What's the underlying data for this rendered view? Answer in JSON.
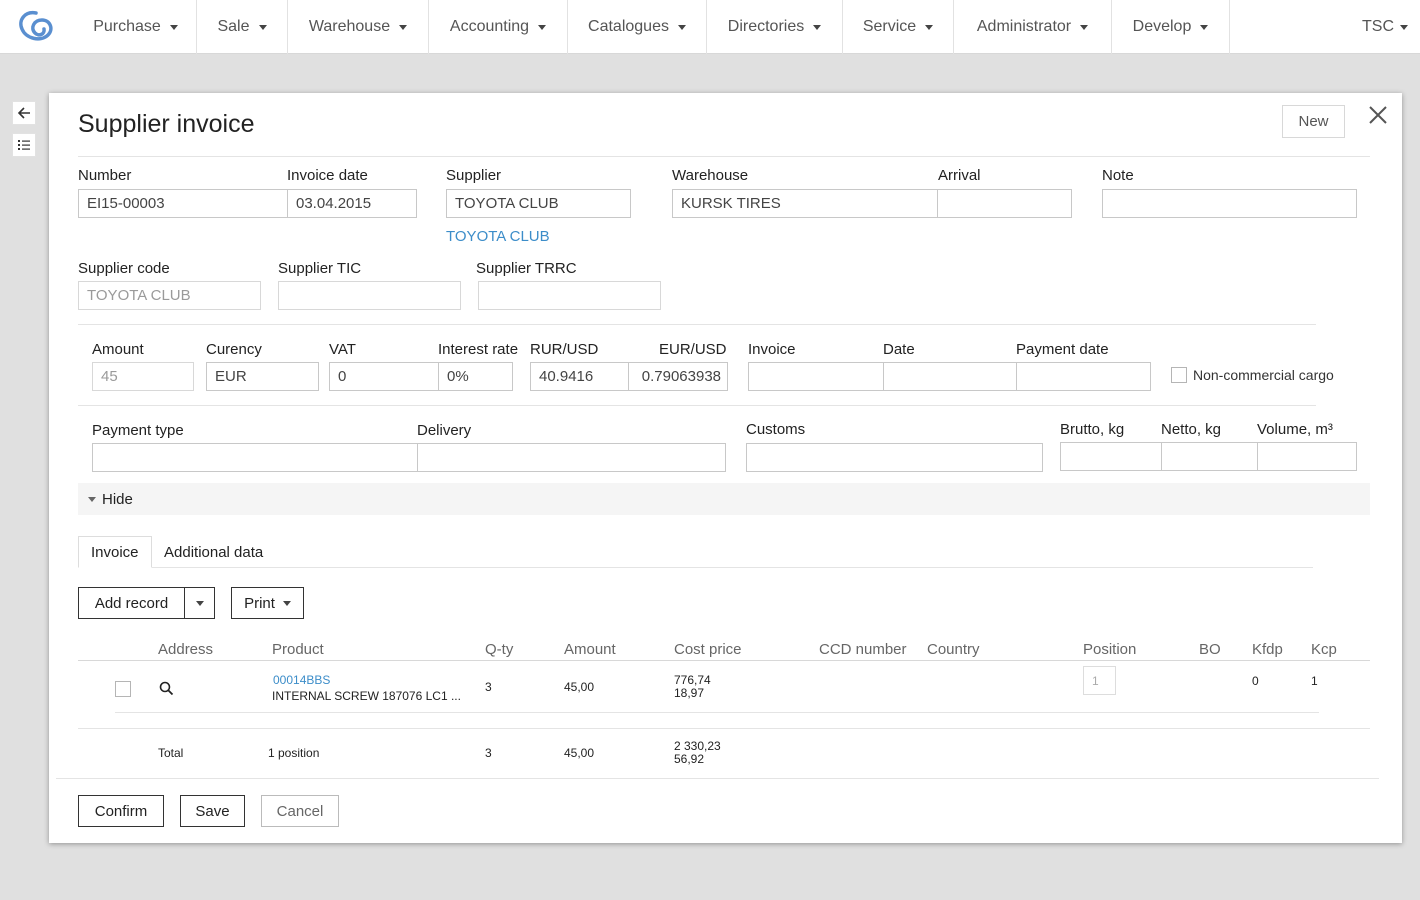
{
  "nav": {
    "items": [
      "Purchase",
      "Sale",
      "Warehouse",
      "Accounting",
      "Catalogues",
      "Directories",
      "Service",
      "Administrator",
      "Develop"
    ],
    "user": "TSC"
  },
  "modal": {
    "title": "Supplier invoice",
    "new_label": "New"
  },
  "header_fields": {
    "number_label": "Number",
    "number_value": "EI15-00003",
    "invoice_date_label": "Invoice date",
    "invoice_date_value": "03.04.2015",
    "supplier_label": "Supplier",
    "supplier_value": "TOYOTA CLUB",
    "supplier_link": "TOYOTA CLUB",
    "warehouse_label": "Warehouse",
    "warehouse_value": "KURSK TIRES",
    "arrival_label": "Arrival",
    "arrival_value": "",
    "note_label": "Note",
    "note_value": ""
  },
  "supplier_fields": {
    "code_label": "Supplier code",
    "code_value": "TOYOTA CLUB",
    "tic_label": "Supplier TIC",
    "tic_value": "",
    "trrc_label": "Supplier TRRC",
    "trrc_value": ""
  },
  "finance": {
    "amount_label": "Amount",
    "amount_value": "45",
    "currency_label": "Curency",
    "currency_value": "EUR",
    "vat_label": "VAT",
    "vat_value": "0",
    "interest_label": "Interest rate",
    "interest_value": "0%",
    "rur_usd_label": "RUR/USD",
    "rur_usd_value": "40.9416",
    "eur_usd_label": "EUR/USD",
    "eur_usd_value": "0.79063938",
    "invoice_label": "Invoice",
    "invoice_value": "",
    "date_label": "Date",
    "date_value": "",
    "payment_date_label": "Payment date",
    "payment_date_value": "",
    "noncommercial_label": "Non-commercial cargo"
  },
  "logistics": {
    "payment_type_label": "Payment type",
    "payment_type_value": "",
    "delivery_label": "Delivery",
    "delivery_value": "",
    "customs_label": "Customs",
    "customs_value": "",
    "brutto_label": "Brutto, kg",
    "brutto_value": "",
    "netto_label": "Netto, kg",
    "netto_value": "",
    "volume_label": "Volume, m³",
    "volume_value": ""
  },
  "hide_label": "Hide",
  "tabs": [
    "Invoice",
    "Additional data"
  ],
  "toolbar": {
    "add_record": "Add record",
    "print": "Print"
  },
  "table": {
    "headers": [
      "Address",
      "Product",
      "Q-ty",
      "Amount",
      "Cost price",
      "CCD number",
      "Country",
      "Position",
      "BO",
      "Kfdp",
      "Kcp"
    ],
    "row": {
      "product_code": "00014BBS",
      "product_name": "INTERNAL SCREW 187076 LC1 ...",
      "qty": "3",
      "amount": "45,00",
      "cost_price_1": "776,74",
      "cost_price_2": "18,97",
      "position": "1",
      "kfdp": "0",
      "kcp": "1"
    },
    "total": {
      "label": "Total",
      "positions": "1 position",
      "qty": "3",
      "amount": "45,00",
      "cost_price_1": "2 330,23",
      "cost_price_2": "56,92"
    }
  },
  "footer": {
    "confirm": "Confirm",
    "save": "Save",
    "cancel": "Cancel"
  },
  "colors": {
    "link": "#3c8dc9",
    "logo": "#5a8fd0",
    "backdrop": "#e0e0e0"
  }
}
